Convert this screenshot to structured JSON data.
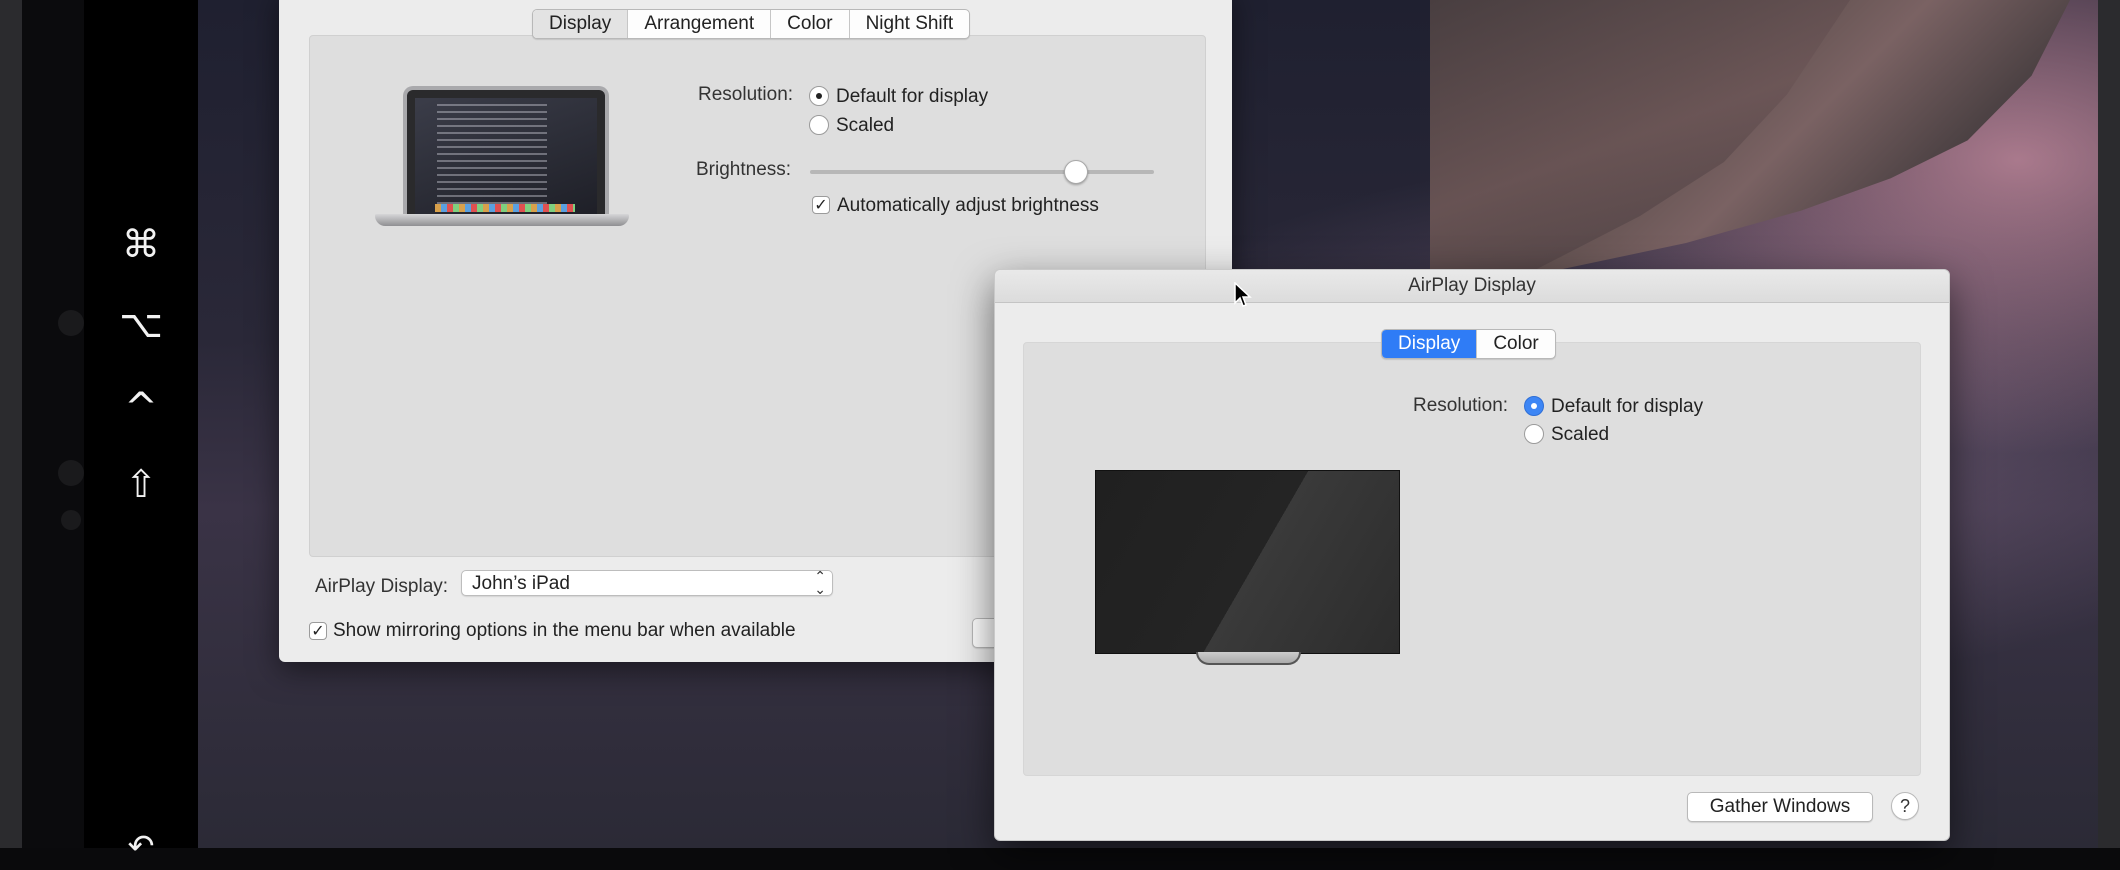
{
  "sidebar": {
    "modifiers": [
      {
        "name": "command-key",
        "glyph": "⌘"
      },
      {
        "name": "option-key",
        "glyph": "⌥"
      },
      {
        "name": "control-key",
        "glyph": "^"
      },
      {
        "name": "shift-key",
        "glyph": "⇧"
      }
    ],
    "undo_glyph": "↶"
  },
  "display_window": {
    "tabs": [
      "Display",
      "Arrangement",
      "Color",
      "Night Shift"
    ],
    "active_tab": "Display",
    "resolution_label": "Resolution:",
    "resolution_options": [
      "Default for display",
      "Scaled"
    ],
    "resolution_selected": "Default for display",
    "brightness_label": "Brightness:",
    "brightness_level": 0.77,
    "auto_brightness_label": "Automatically adjust brightness",
    "auto_brightness_checked": true,
    "airplay_label": "AirPlay Display:",
    "airplay_value": "John’s iPad",
    "mirroring_label": "Show mirroring options in the menu bar when available",
    "mirroring_checked": true
  },
  "airplay_window": {
    "title": "AirPlay Display",
    "tabs": [
      "Display",
      "Color"
    ],
    "active_tab": "Display",
    "resolution_label": "Resolution:",
    "resolution_options": [
      "Default for display",
      "Scaled"
    ],
    "resolution_selected": "Default for display",
    "gather_button": "Gather Windows",
    "help_button": "?"
  },
  "colors": {
    "accent": "#2f7cf6",
    "window_bg": "#ececec"
  },
  "check_glyph": "✓",
  "popup_arrows": "⌃⌄"
}
